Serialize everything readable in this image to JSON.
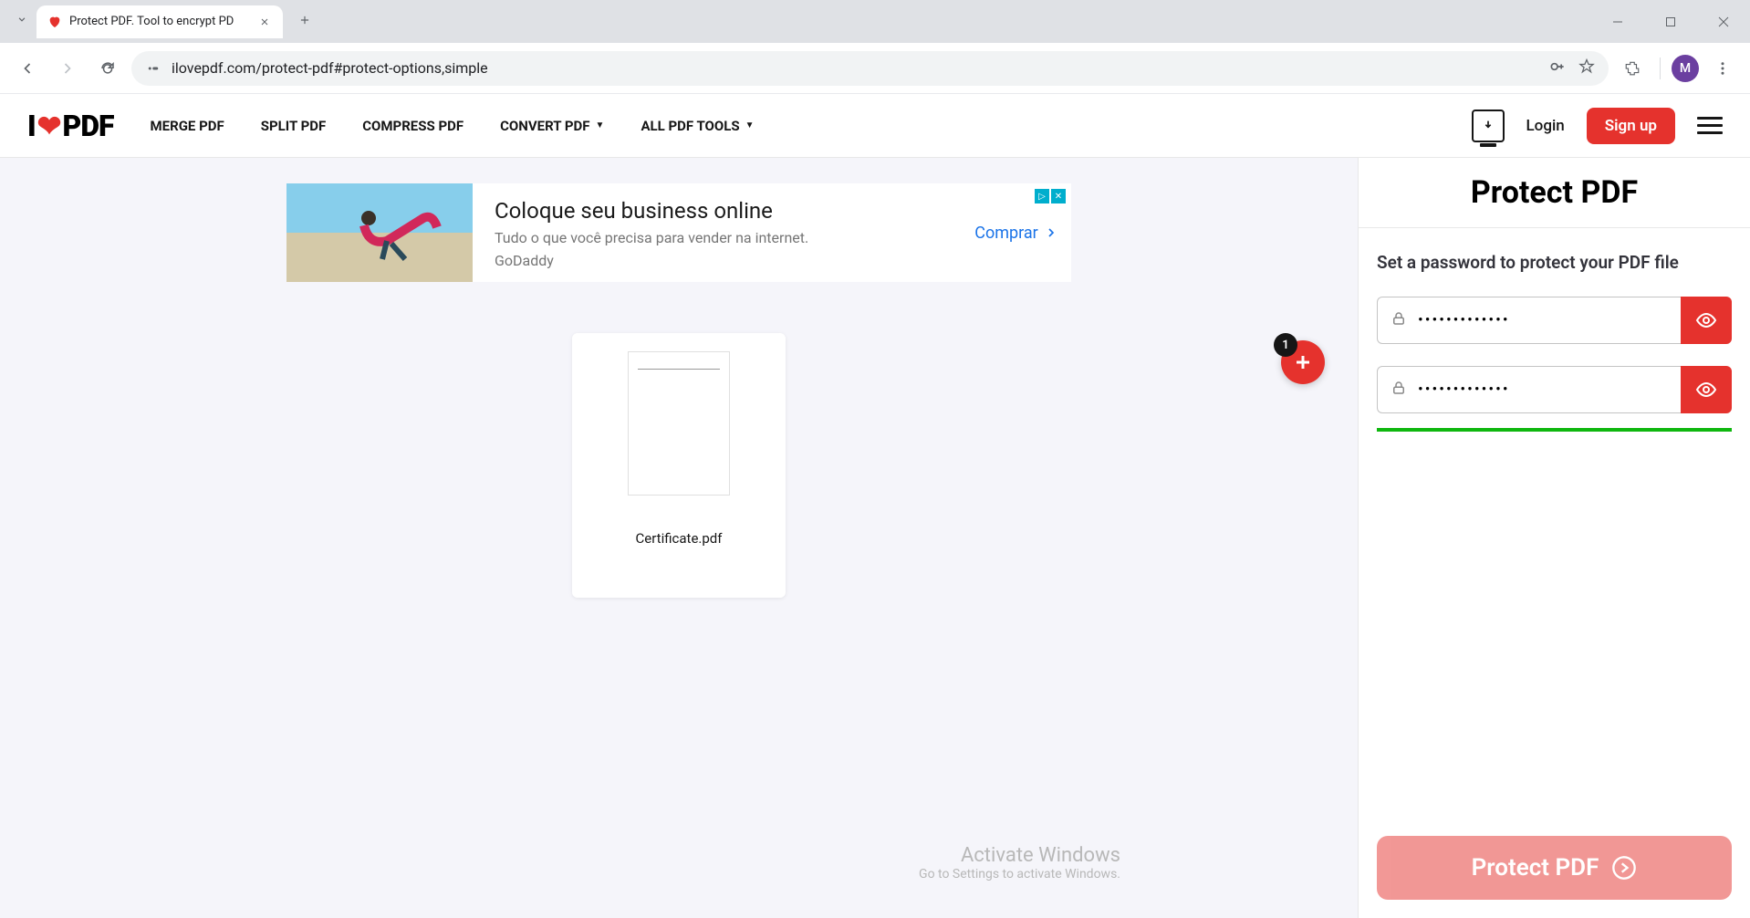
{
  "browser": {
    "tab_title": "Protect PDF. Tool to encrypt PD",
    "url": "ilovepdf.com/protect-pdf#protect-options,simple",
    "profile_initial": "M"
  },
  "header": {
    "logo_i": "I",
    "logo_pdf": "PDF",
    "nav": {
      "merge": "MERGE PDF",
      "split": "SPLIT PDF",
      "compress": "COMPRESS PDF",
      "convert": "CONVERT PDF",
      "alltools": "ALL PDF TOOLS"
    },
    "login": "Login",
    "signup": "Sign up"
  },
  "ad": {
    "headline": "Coloque seu business online",
    "sub": "Tudo o que você precisa para vender na internet.",
    "brand": "GoDaddy",
    "cta": "Comprar"
  },
  "workspace": {
    "file_name": "Certificate.pdf",
    "add_badge": "1"
  },
  "panel": {
    "title": "Protect PDF",
    "instruction": "Set a password to protect your PDF file",
    "password_value": "•••••••••••••",
    "confirm_value": "•••••••••••••",
    "submit": "Protect PDF"
  },
  "watermark": {
    "title": "Activate Windows",
    "sub": "Go to Settings to activate Windows."
  }
}
